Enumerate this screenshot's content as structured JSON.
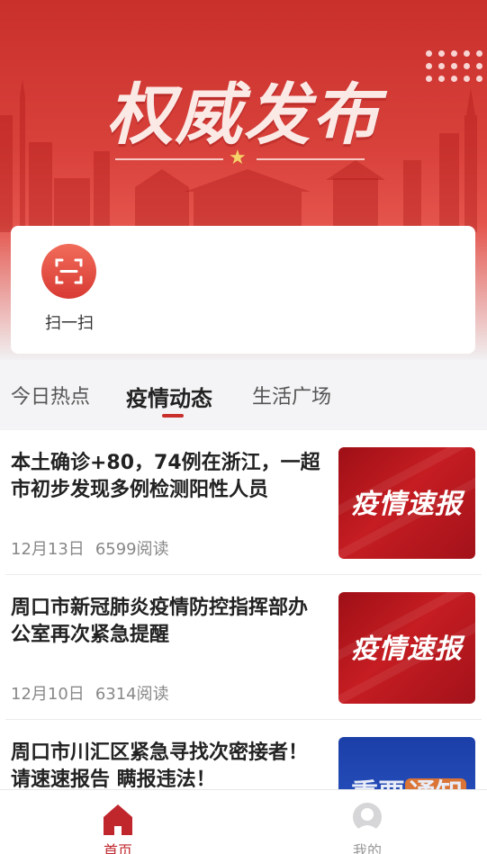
{
  "hero": {
    "title": "权威发布"
  },
  "scan": {
    "label": "扫一扫"
  },
  "tabs": [
    {
      "label": "今日热点"
    },
    {
      "label": "疫情动态"
    },
    {
      "label": "生活广场"
    }
  ],
  "feed": [
    {
      "title": "本土确诊+80，74例在浙江，一超市初步发现多例检测阳性人员",
      "date": "12月13日",
      "reads": "6599阅读",
      "thumb_text": "疫情速报"
    },
    {
      "title": "周口市新冠肺炎疫情防控指挥部办公室再次紧急提醒",
      "date": "12月10日",
      "reads": "6314阅读",
      "thumb_text": "疫情速报"
    },
    {
      "title": "周口市川汇区紧急寻找次密接者！请速速报告 瞒报违法！",
      "thumb_text_a": "重要",
      "thumb_text_b": "通知"
    }
  ],
  "nav": {
    "home": "首页",
    "mine": "我的"
  },
  "colors": {
    "brand_red": "#c9302c",
    "nav_inactive": "#999999"
  }
}
